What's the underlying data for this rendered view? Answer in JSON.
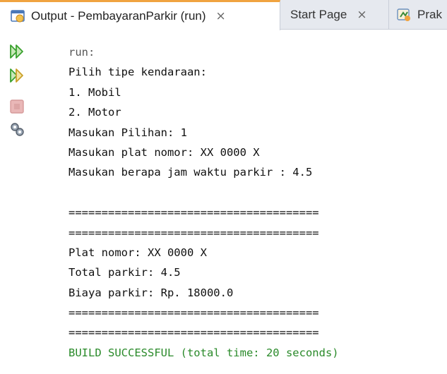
{
  "tabs": [
    {
      "label": "Output - PembayaranParkir (run)",
      "active": true,
      "close": "×"
    },
    {
      "label": "Start Page",
      "active": false,
      "close": "×"
    },
    {
      "label": "Prak",
      "active": false
    }
  ],
  "toolbar": {
    "buttons": [
      {
        "icon": "rerun-icon"
      },
      {
        "icon": "rerun-with-options-icon"
      },
      {
        "icon": "stop-icon"
      },
      {
        "icon": "settings-icon"
      }
    ]
  },
  "console": {
    "lines": [
      "run:",
      "Pilih tipe kendaraan:",
      "1. Mobil",
      "2. Motor",
      "Masukan Pilihan: 1",
      "Masukan plat nomor: XX 0000 X",
      "Masukan berapa jam waktu parkir : 4.5",
      "",
      "======================================",
      "======================================",
      "Plat nomor: XX 0000 X",
      "Total parkir: 4.5",
      "Biaya parkir: Rp. 18000.0",
      "======================================",
      "======================================",
      "BUILD SUCCESSFUL (total time: 20 seconds)"
    ]
  },
  "colors": {
    "success": "#2a8a2a",
    "tab_accent": "#f0a340",
    "run_green": "#3aa12f"
  }
}
